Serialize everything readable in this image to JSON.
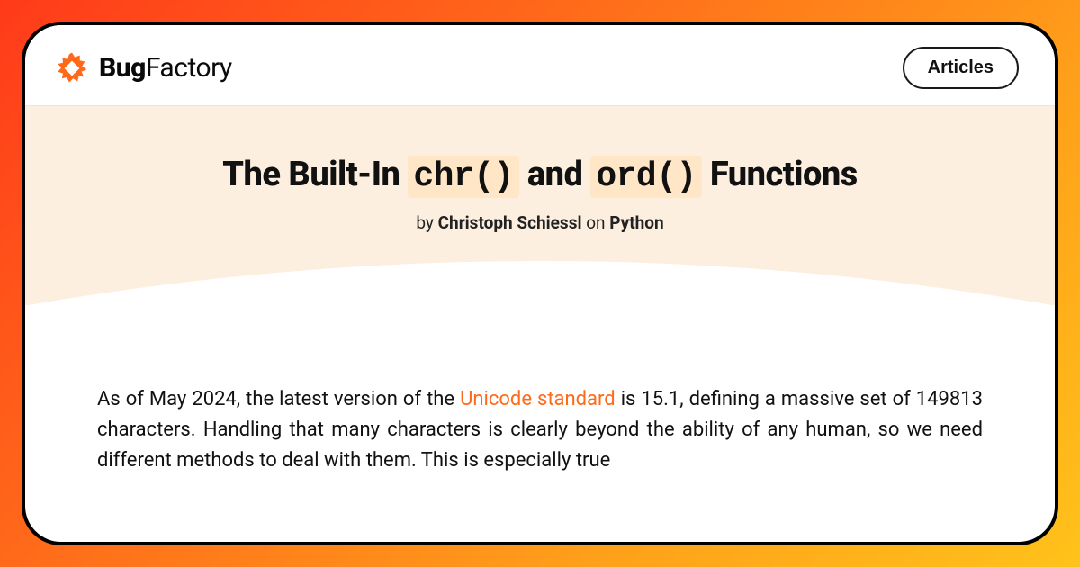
{
  "brand": {
    "bold": "Bug",
    "rest": "Factory"
  },
  "nav": {
    "articles": "Articles"
  },
  "title": {
    "pre": "The Built-In ",
    "code1": "chr()",
    "mid": " and ",
    "code2": "ord()",
    "post": " Functions"
  },
  "byline": {
    "by": "by ",
    "author": "Christoph Schiessl",
    "on": " on ",
    "topic": "Python"
  },
  "body": {
    "p1a": "As of May 2024, the latest version of the ",
    "link": "Unicode standard",
    "p1b": " is 15.1, defining a massive set of 149813 characters. Handling that many characters is clearly beyond the ability of any human, so we need different methods to deal with them. This is especially true"
  },
  "colors": {
    "accent": "#ff6a1a"
  }
}
